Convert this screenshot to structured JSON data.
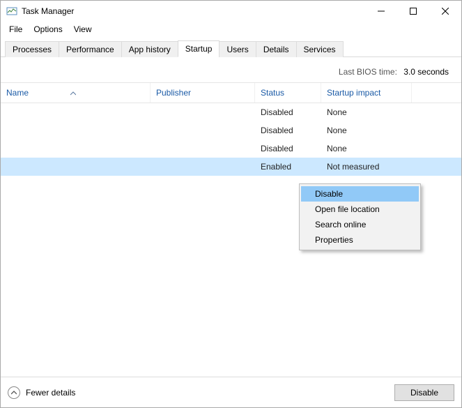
{
  "titlebar": {
    "title": "Task Manager"
  },
  "menu": {
    "file": "File",
    "options": "Options",
    "view": "View"
  },
  "tabs": {
    "processes": "Processes",
    "performance": "Performance",
    "app_history": "App history",
    "startup": "Startup",
    "users": "Users",
    "details": "Details",
    "services": "Services"
  },
  "info": {
    "bios_label": "Last BIOS time:",
    "bios_value": "3.0 seconds"
  },
  "columns": {
    "name": "Name",
    "publisher": "Publisher",
    "status": "Status",
    "impact": "Startup impact"
  },
  "rows": [
    {
      "name": "",
      "publisher": "",
      "status": "Disabled",
      "impact": "None"
    },
    {
      "name": "",
      "publisher": "",
      "status": "Disabled",
      "impact": "None"
    },
    {
      "name": "",
      "publisher": "",
      "status": "Disabled",
      "impact": "None"
    },
    {
      "name": "",
      "publisher": "",
      "status": "Enabled",
      "impact": "Not measured"
    }
  ],
  "context_menu": {
    "disable": "Disable",
    "open_location": "Open file location",
    "search_online": "Search online",
    "properties": "Properties"
  },
  "bottom": {
    "fewer": "Fewer details",
    "disable_btn": "Disable"
  }
}
